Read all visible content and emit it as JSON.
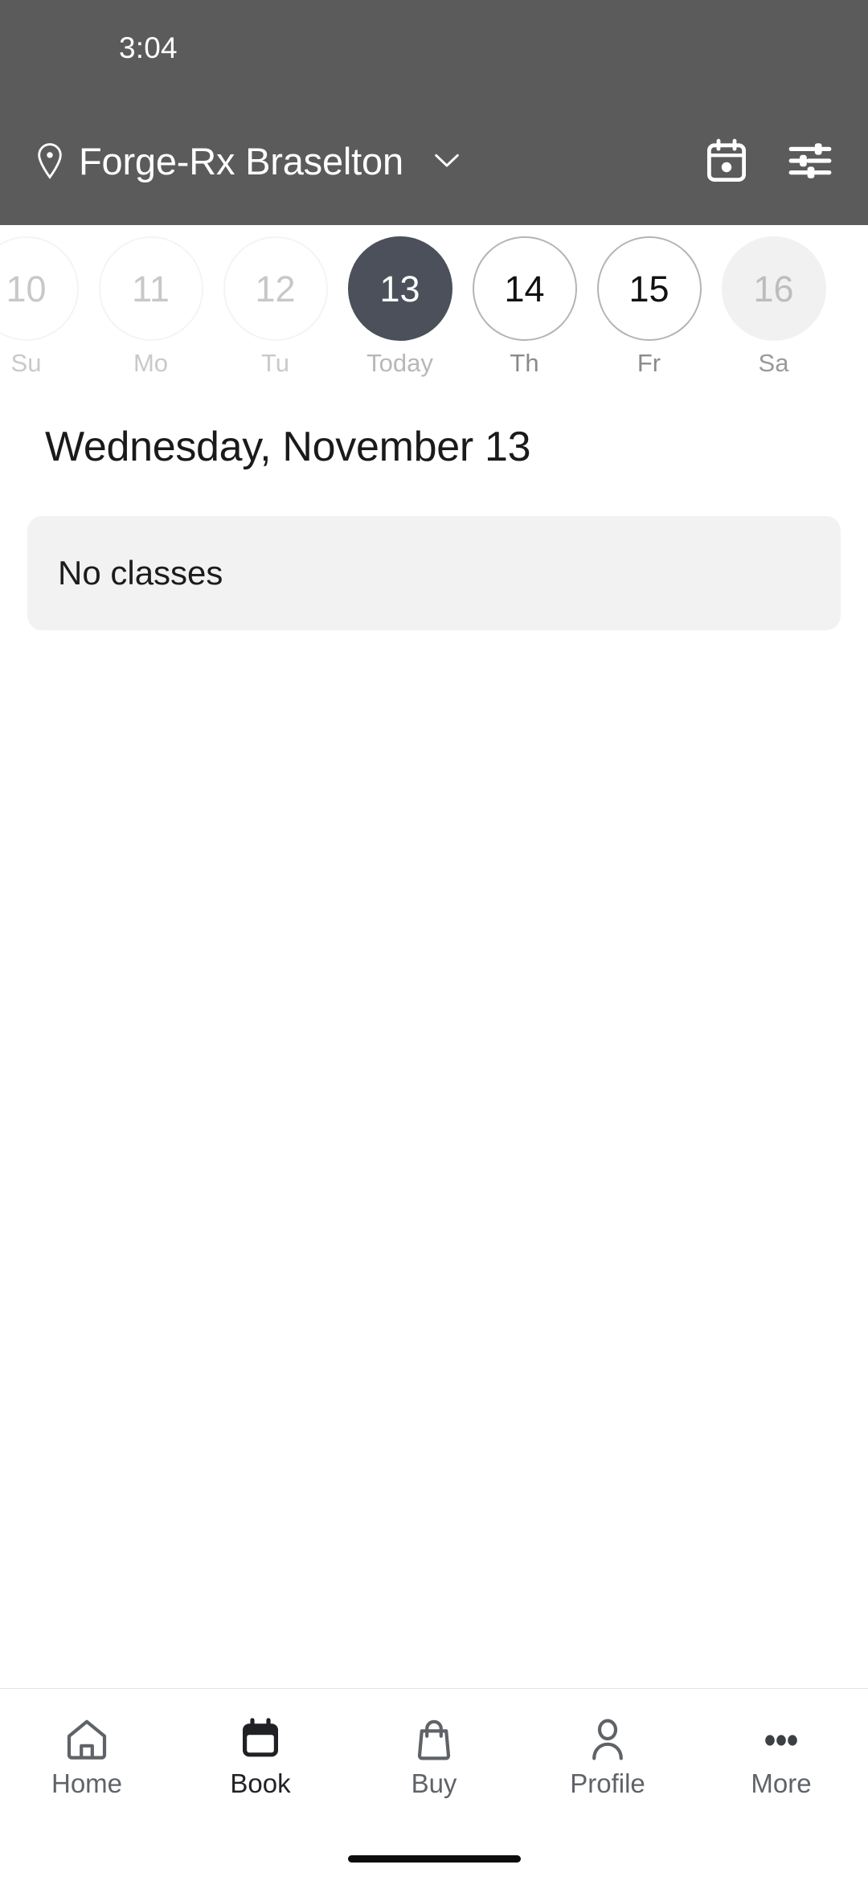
{
  "status_bar": {
    "time": "3:04"
  },
  "header": {
    "pin_icon": "location-pin-icon",
    "location_name": "Forge-Rx Braselton",
    "chevron_icon": "chevron-down-icon",
    "calendar_action_icon": "calendar-today-icon",
    "filter_action_icon": "tune-filter-icon",
    "background_color": "#5b5b5b"
  },
  "date_strip": {
    "days": [
      {
        "date": "10",
        "label": "Su",
        "state": "past"
      },
      {
        "date": "11",
        "label": "Mo",
        "state": "past"
      },
      {
        "date": "12",
        "label": "Tu",
        "state": "past"
      },
      {
        "date": "13",
        "label": "Today",
        "state": "today"
      },
      {
        "date": "14",
        "label": "Th",
        "state": "future"
      },
      {
        "date": "15",
        "label": "Fr",
        "state": "future"
      },
      {
        "date": "16",
        "label": "Sa",
        "state": "dim"
      }
    ],
    "selected_color": "#4b505a"
  },
  "main": {
    "date_heading": "Wednesday, November 13",
    "empty_state": "No classes",
    "empty_card_color": "#f2f2f2"
  },
  "bottom_nav": {
    "items": [
      {
        "label": "Home",
        "icon": "home-icon",
        "active": false
      },
      {
        "label": "Book",
        "icon": "calendar-icon",
        "active": true
      },
      {
        "label": "Buy",
        "icon": "shopping-bag-icon",
        "active": false
      },
      {
        "label": "Profile",
        "icon": "person-icon",
        "active": false
      },
      {
        "label": "More",
        "icon": "more-dots-icon",
        "active": false
      }
    ]
  }
}
